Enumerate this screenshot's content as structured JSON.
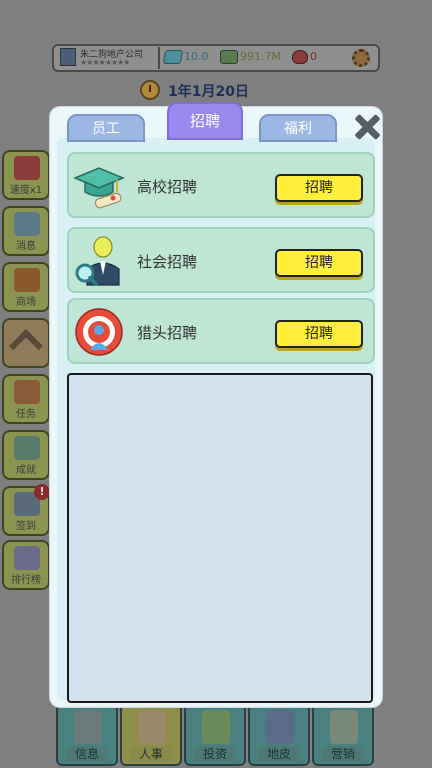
{
  "hud": {
    "company_name": "朱二狗地产公司",
    "company_stars": "★★★★★★★★",
    "gems": "10.0",
    "money": "991.7M",
    "hearts": "0",
    "date": "1年1月20日"
  },
  "side_menu": [
    {
      "id": "speed",
      "label": "速度x1",
      "color": "#8a3a3a"
    },
    {
      "id": "message",
      "label": "消息",
      "color": "#5a7a8a"
    },
    {
      "id": "shop",
      "label": "商场",
      "color": "#8a5a2a"
    },
    {
      "id": "collapse",
      "label": ""
    },
    {
      "id": "task",
      "label": "任务",
      "color": "#8a5a3a"
    },
    {
      "id": "achievement",
      "label": "成就",
      "color": "#5a7a6a"
    },
    {
      "id": "checkin",
      "label": "签到",
      "color": "#5a6a7a",
      "badge": "!"
    },
    {
      "id": "ranking",
      "label": "排行榜",
      "color": "#6a6a8a"
    }
  ],
  "bottom_nav": [
    {
      "id": "info",
      "label": "信息"
    },
    {
      "id": "hr",
      "label": "人事"
    },
    {
      "id": "invest",
      "label": "投资"
    },
    {
      "id": "land",
      "label": "地皮"
    },
    {
      "id": "marketing",
      "label": "营销"
    }
  ],
  "dialog": {
    "tabs": [
      "员工",
      "招聘",
      "福利"
    ],
    "active_tab": "招聘",
    "rows": [
      {
        "id": "campus",
        "label": "高校招聘",
        "button": "招聘",
        "icon": "graduation-cap-icon"
      },
      {
        "id": "social",
        "label": "社会招聘",
        "button": "招聘",
        "icon": "magnifier-person-icon"
      },
      {
        "id": "headhunt",
        "label": "猎头招聘",
        "button": "招聘",
        "icon": "target-person-icon"
      }
    ]
  },
  "colors": {
    "tab_inactive": "#9eb8e6",
    "tab_active": "#9b88ee",
    "row_bg": "#bfe6d4",
    "button_yellow": "#ffef3a",
    "panel_bg": "#d3e2ec"
  }
}
